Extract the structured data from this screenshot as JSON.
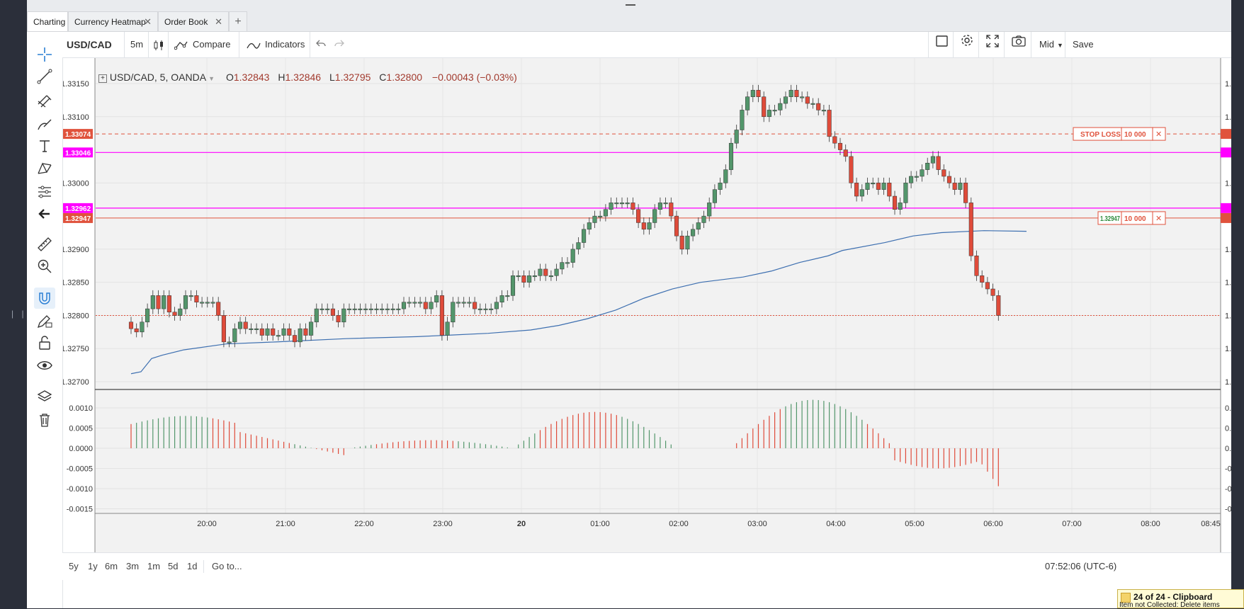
{
  "tabs": [
    {
      "label": "Charting",
      "active": true
    },
    {
      "label": "Currency Heatmap",
      "active": false
    },
    {
      "label": "Order Book",
      "active": false
    }
  ],
  "tab_add_icon": "+",
  "toolbar": {
    "symbol": "USD/CAD",
    "interval": "5m",
    "compare": "Compare",
    "indicators": "Indicators",
    "price_mode": "Mid",
    "save": "Save"
  },
  "legend": {
    "title": "USD/CAD, 5, OANDA",
    "o_label": "O",
    "o_value": "1.32843",
    "h_label": "H",
    "h_value": "1.32846",
    "l_label": "L",
    "l_value": "1.32795",
    "c_label": "C",
    "c_value": "1.32800",
    "change": "−0.00043 (−0.03%)"
  },
  "price_scale": [
    "1.33150",
    "1.33100",
    "1.33000",
    "1.32900",
    "1.32850",
    "1.32800",
    "1.32750",
    "1.32700"
  ],
  "price_badges": [
    {
      "label": "1.33074",
      "color": "#e0523c"
    },
    {
      "label": "1.33046",
      "color": "#ff00ff"
    },
    {
      "label": "1.32962",
      "color": "#ff00ff"
    },
    {
      "label": "1.32947",
      "color": "#e0523c"
    }
  ],
  "osc_scale": [
    "0.0010",
    "0.0005",
    "0.0000",
    "-0.0005",
    "-0.0010",
    "-0.0015"
  ],
  "time_axis": [
    "20:00",
    "21:00",
    "22:00",
    "23:00",
    "20",
    "01:00",
    "02:00",
    "03:00",
    "04:00",
    "05:00",
    "06:00",
    "07:00",
    "08:00",
    "08:45"
  ],
  "orders": {
    "stop_loss_label": "STOP LOSS",
    "stop_loss_qty": "10 000",
    "position_price": "1.32947",
    "position_qty": "10 000"
  },
  "periods": [
    "5y",
    "1y",
    "6m",
    "3m",
    "1m",
    "5d",
    "1d"
  ],
  "goto": "Go to...",
  "clock": "07:52:06 (UTC-6)",
  "clipboard": {
    "title": "24 of 24 - Clipboard",
    "subtitle": "Item not Collected: Delete items"
  },
  "colors": {
    "up": "#53966b",
    "down": "#df4b3a",
    "ma": "#3d6fb0",
    "magenta": "#ff00ff",
    "stoploss": "#e0523c",
    "chart_bg": "#f2f2f2"
  },
  "icons": [
    "crosshair-icon",
    "trend-line-icon",
    "pitchfork-icon",
    "brush-icon",
    "text-icon",
    "pattern-icon",
    "forecast-icon",
    "back-arrow-icon",
    "ruler-icon",
    "zoom-icon",
    "magnet-icon",
    "pencil-lock-icon",
    "unlock-icon",
    "eye-icon",
    "layers-icon",
    "trash-icon"
  ]
}
